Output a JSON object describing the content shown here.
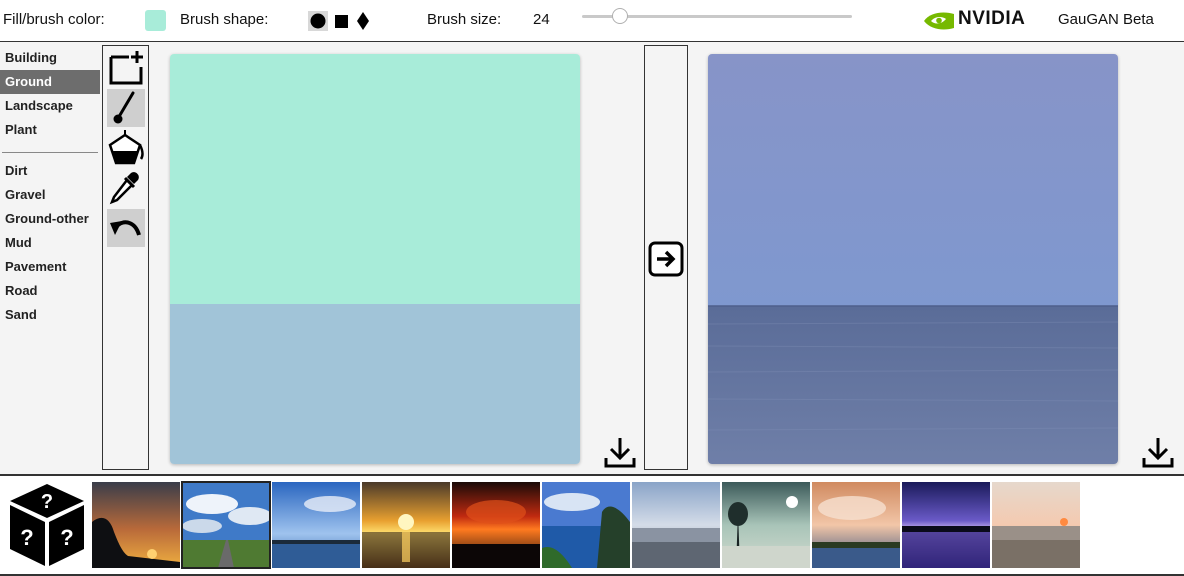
{
  "topbar": {
    "fill_label": "Fill/brush color:",
    "fill_color": "#a8ecd9",
    "shape_label": "Brush shape:",
    "shapes": [
      "circle-brush",
      "square-brush",
      "diamond-brush"
    ],
    "size_label": "Brush size:",
    "size_value": "24",
    "size_fraction": 0.14,
    "brand": "NVIDIA",
    "brand_color": "#76b900",
    "app_title": "GauGAN Beta"
  },
  "labels": {
    "group1": [
      {
        "label": "Building",
        "active": false
      },
      {
        "label": "Ground",
        "active": true
      },
      {
        "label": "Landscape",
        "active": false
      },
      {
        "label": "Plant",
        "active": false
      }
    ],
    "group2": [
      {
        "label": "Dirt"
      },
      {
        "label": "Gravel"
      },
      {
        "label": "Ground-other"
      },
      {
        "label": "Mud"
      },
      {
        "label": "Pavement"
      },
      {
        "label": "Road"
      },
      {
        "label": "Sand"
      }
    ]
  },
  "tools": [
    {
      "name": "new-canvas-icon",
      "selected": false
    },
    {
      "name": "brush-icon",
      "selected": true
    },
    {
      "name": "paint-bucket-icon",
      "selected": false
    },
    {
      "name": "eyedropper-icon",
      "selected": false
    },
    {
      "name": "undo-icon",
      "selected": true
    }
  ],
  "canvas": {
    "top_color": "#a8ecd9",
    "bottom_color": "#a1c4d8",
    "split_fraction": 0.61
  },
  "output": {
    "sky_top": "#8794c8",
    "sky_bottom": "#7f98cf",
    "sea_top": "#5a6c98",
    "sea_bottom": "#6f7fa8"
  },
  "thumbnails": [
    {
      "name": "thumb-sunset-trees",
      "selected": false
    },
    {
      "name": "thumb-road-clouds",
      "selected": true
    },
    {
      "name": "thumb-lake-blue",
      "selected": false
    },
    {
      "name": "thumb-golden-sunset",
      "selected": false
    },
    {
      "name": "thumb-red-sunset",
      "selected": false
    },
    {
      "name": "thumb-cliff-bay",
      "selected": false
    },
    {
      "name": "thumb-grey-beach",
      "selected": false
    },
    {
      "name": "thumb-moonlit-shore",
      "selected": false
    },
    {
      "name": "thumb-pink-clouds",
      "selected": false
    },
    {
      "name": "thumb-purple-lake",
      "selected": false
    },
    {
      "name": "thumb-pale-sunset-beach",
      "selected": false
    }
  ]
}
